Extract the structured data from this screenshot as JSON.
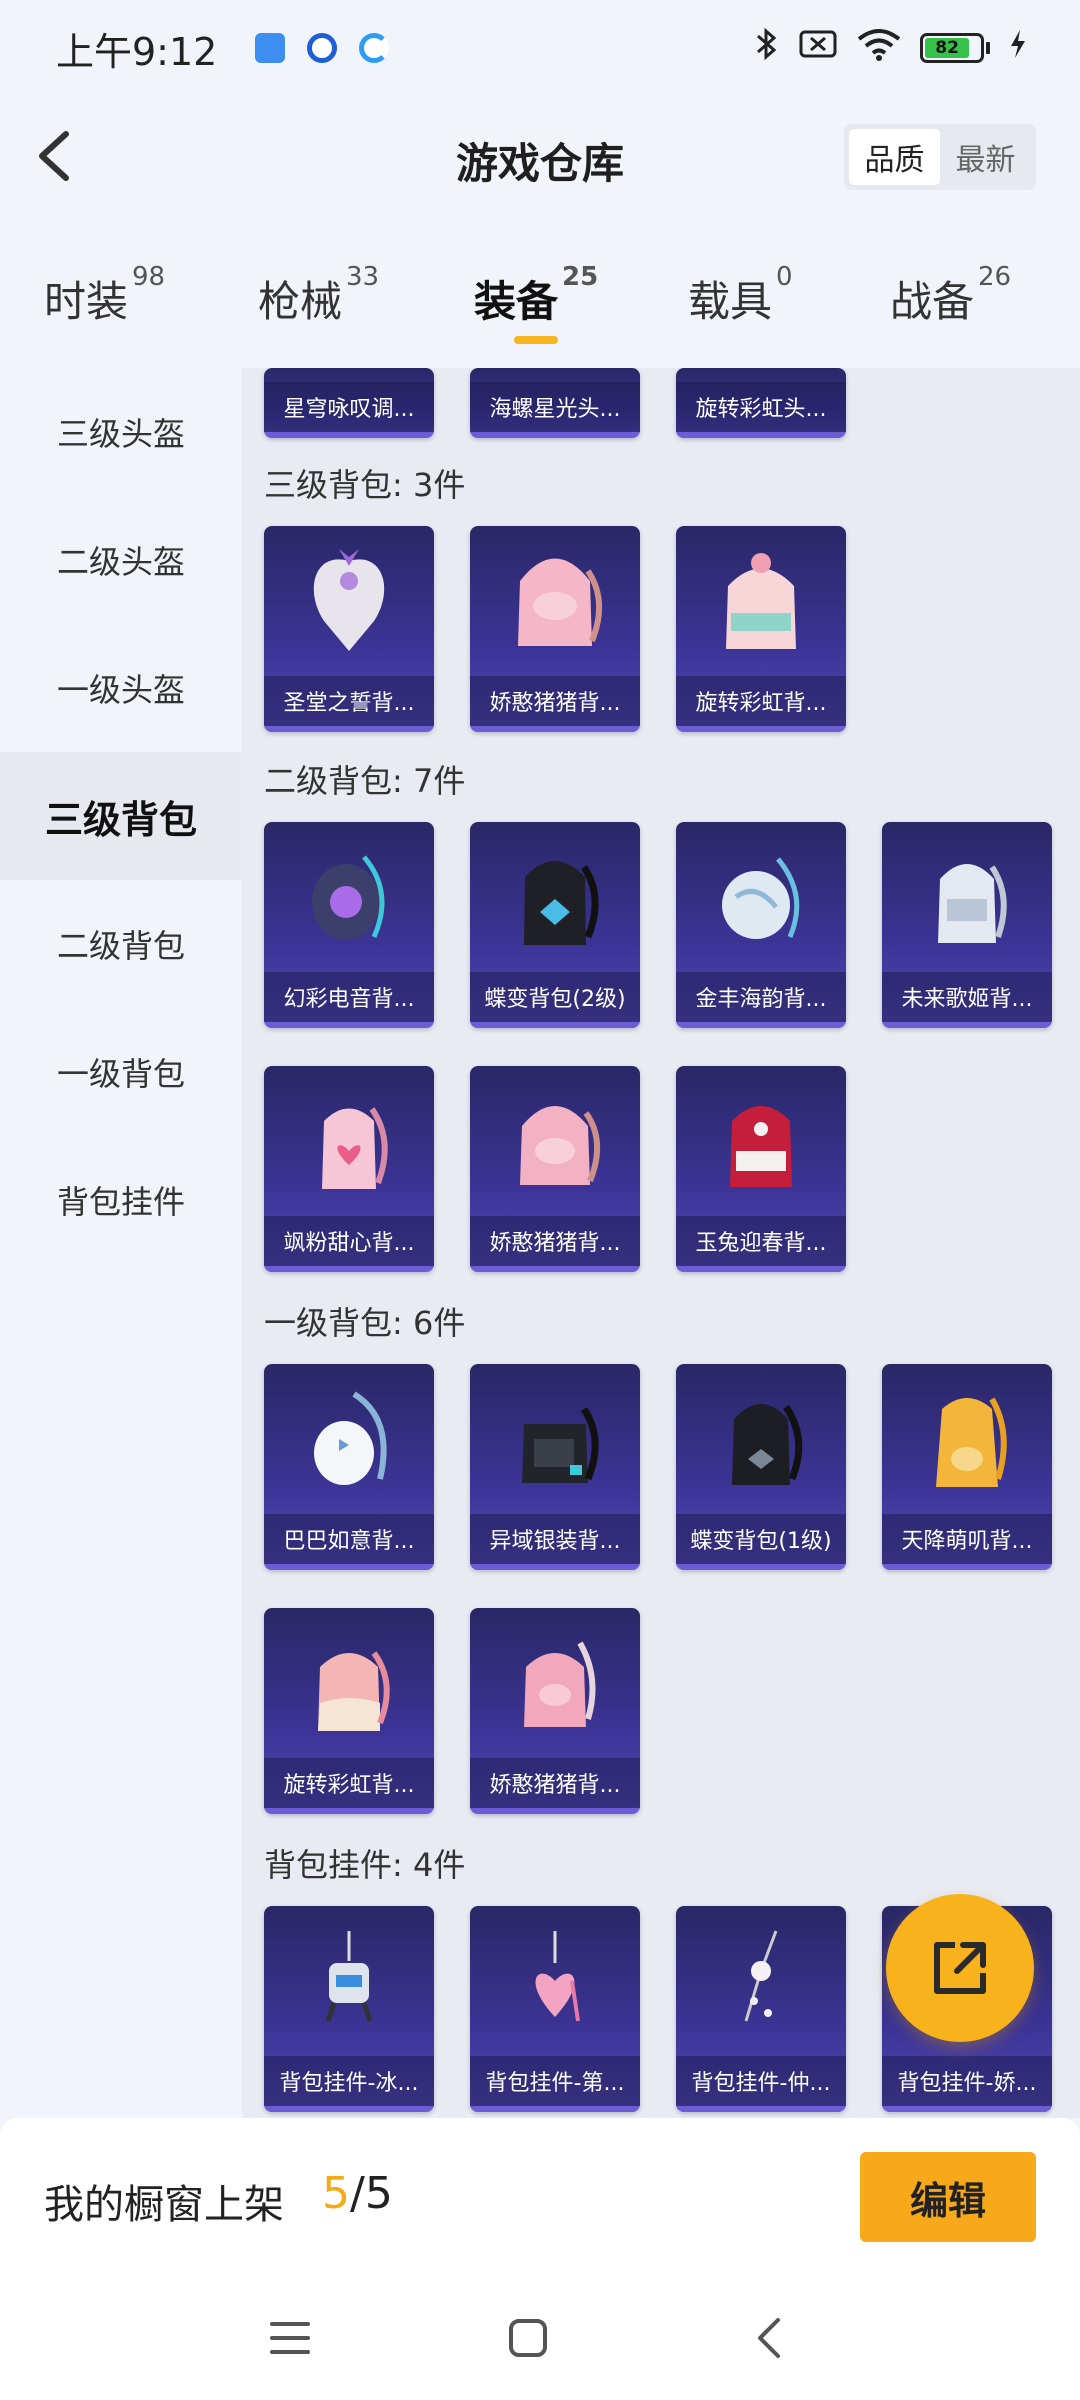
{
  "status_bar": {
    "time": "上午9:12",
    "battery": "82"
  },
  "header": {
    "title": "游戏仓库",
    "sort_options": [
      "品质",
      "最新"
    ]
  },
  "tabs": [
    {
      "label": "时装",
      "count": "98"
    },
    {
      "label": "枪械",
      "count": "33"
    },
    {
      "label": "装备",
      "count": "25"
    },
    {
      "label": "载具",
      "count": "0"
    },
    {
      "label": "战备",
      "count": "26"
    }
  ],
  "sidebar": {
    "items": [
      "三级头盔",
      "二级头盔",
      "一级头盔",
      "三级背包",
      "二级背包",
      "一级背包",
      "背包挂件"
    ]
  },
  "sections": {
    "partial_top": [
      "星穹咏叹调...",
      "海螺星光头...",
      "旋转彩虹头..."
    ],
    "lv3_backpack": {
      "title": "三级背包: 3件",
      "items": [
        "圣堂之誓背...",
        "娇憨猪猪背...",
        "旋转彩虹背..."
      ]
    },
    "lv2_backpack": {
      "title": "二级背包: 7件",
      "items": [
        "幻彩电音背...",
        "蝶变背包(2级)",
        "金丰海韵背...",
        "未来歌姬背...",
        "飒粉甜心背...",
        "娇憨猪猪背...",
        "玉兔迎春背..."
      ]
    },
    "lv1_backpack": {
      "title": "一级背包: 6件",
      "items": [
        "巴巴如意背...",
        "异域银装背...",
        "蝶变背包(1级)",
        "天降萌叽背...",
        "旋转彩虹背...",
        "娇憨猪猪背..."
      ]
    },
    "pendant": {
      "title": "背包挂件: 4件",
      "items": [
        "背包挂件-冰...",
        "背包挂件-第...",
        "背包挂件-仲...",
        "背包挂件-娇..."
      ]
    }
  },
  "bottom_bar": {
    "label": "我的橱窗上架",
    "current": "5",
    "total": "/5",
    "edit_label": "编辑"
  },
  "colors": {
    "accent": "#f7a91a",
    "card_bg": "#3c3496"
  }
}
